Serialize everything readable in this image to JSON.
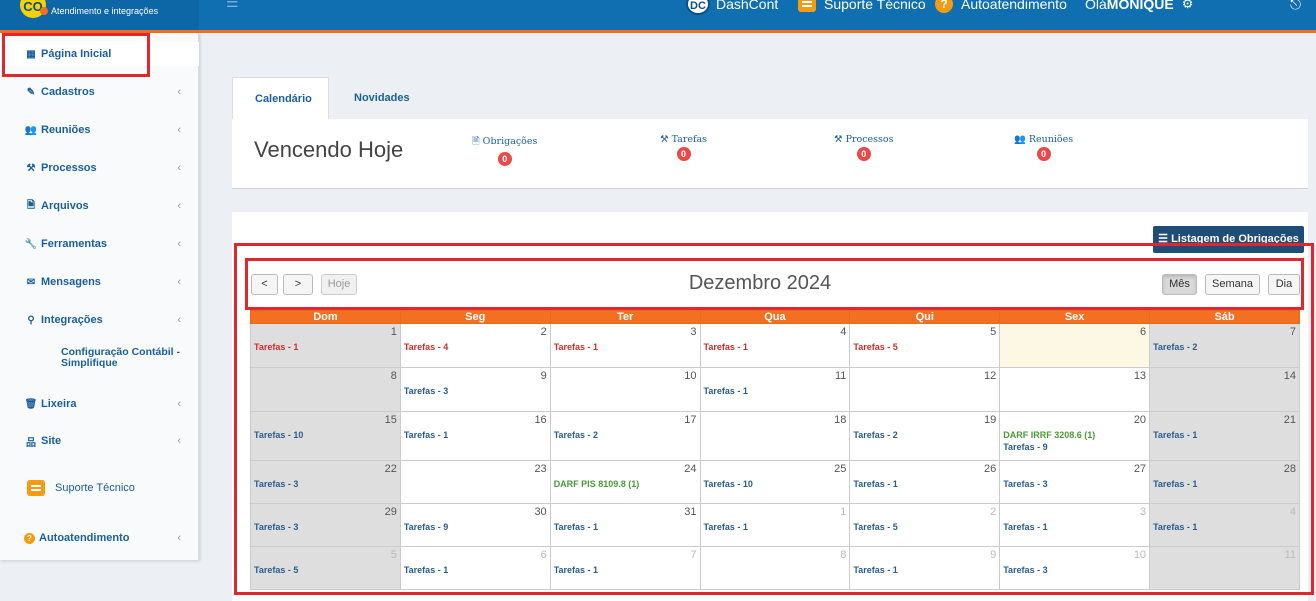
{
  "brand": {
    "logo_text": "CO",
    "subtitle": "Atendimento e integrações"
  },
  "topnav": {
    "dashcont": "DashCont",
    "dashcont_logo": "DC",
    "suporte": "Suporte Técnico",
    "autoatendimento": "Autoatendimento",
    "greeting_prefix": "Olá ",
    "user": "MONIQUE"
  },
  "sidebar": {
    "items": [
      {
        "label": "Página Inicial",
        "icon": "dashboard-icon",
        "glyph": "▦"
      },
      {
        "label": "Cadastros",
        "icon": "edit-icon",
        "glyph": "✎"
      },
      {
        "label": "Reuniões",
        "icon": "users-icon",
        "glyph": "👥"
      },
      {
        "label": "Processos",
        "icon": "gavel-icon",
        "glyph": "⚒"
      },
      {
        "label": "Arquivos",
        "icon": "file-icon",
        "glyph": "🗎"
      },
      {
        "label": "Ferramentas",
        "icon": "wrench-icon",
        "glyph": "🔧"
      },
      {
        "label": "Mensagens",
        "icon": "envelope-icon",
        "glyph": "✉"
      },
      {
        "label": "Integrações",
        "icon": "plug-icon",
        "glyph": "⚲"
      },
      {
        "label": "Lixeira",
        "icon": "trash-icon",
        "glyph": "🗑"
      },
      {
        "label": "Site",
        "icon": "sitemap-icon",
        "glyph": "品"
      },
      {
        "label": "Suporte Técnico",
        "icon": "chat-icon"
      },
      {
        "label": "Autoatendimento",
        "icon": "help-icon"
      }
    ],
    "integracoes_sub": "Configuração Contábil - Simplifique"
  },
  "tabs": [
    "Calendário",
    "Novidades"
  ],
  "vencendo": {
    "title": "Vencendo Hoje",
    "stats": [
      {
        "label": "Obrigações",
        "count": "0",
        "glyph": "🗎"
      },
      {
        "label": "Tarefas",
        "count": "0",
        "glyph": "⚒"
      },
      {
        "label": "Processos",
        "count": "0",
        "glyph": "⚒"
      },
      {
        "label": "Reuniões",
        "count": "0",
        "glyph": "👥"
      }
    ]
  },
  "calendar": {
    "listagem_button": "Listagem de Obrigações",
    "prev": "<",
    "next": ">",
    "today_button": "Hoje",
    "title": "Dezembro 2024",
    "views": [
      "Mês",
      "Semana",
      "Dia"
    ],
    "weekdays": [
      "Dom",
      "Seg",
      "Ter",
      "Qua",
      "Qui",
      "Sex",
      "Sáb"
    ],
    "weeks": [
      [
        {
          "d": "1",
          "ev": [
            [
              "Tarefas - 1",
              "red"
            ]
          ]
        },
        {
          "d": "2",
          "ev": [
            [
              "Tarefas - 4",
              "red"
            ]
          ]
        },
        {
          "d": "3",
          "ev": [
            [
              "Tarefas - 1",
              "red"
            ]
          ]
        },
        {
          "d": "4",
          "ev": [
            [
              "Tarefas - 1",
              "red"
            ]
          ]
        },
        {
          "d": "5",
          "ev": [
            [
              "Tarefas - 5",
              "red"
            ]
          ]
        },
        {
          "d": "6",
          "ev": [],
          "today": true
        },
        {
          "d": "7",
          "ev": [
            [
              "Tarefas - 2",
              "blue"
            ]
          ]
        }
      ],
      [
        {
          "d": "8",
          "ev": []
        },
        {
          "d": "9",
          "ev": [
            [
              "Tarefas - 3",
              "blue"
            ]
          ]
        },
        {
          "d": "10",
          "ev": []
        },
        {
          "d": "11",
          "ev": [
            [
              "Tarefas - 1",
              "blue"
            ]
          ]
        },
        {
          "d": "12",
          "ev": []
        },
        {
          "d": "13",
          "ev": []
        },
        {
          "d": "14",
          "ev": []
        }
      ],
      [
        {
          "d": "15",
          "ev": [
            [
              "Tarefas - 10",
              "blue"
            ]
          ]
        },
        {
          "d": "16",
          "ev": [
            [
              "Tarefas - 1",
              "blue"
            ]
          ]
        },
        {
          "d": "17",
          "ev": [
            [
              "Tarefas - 2",
              "blue"
            ]
          ]
        },
        {
          "d": "18",
          "ev": []
        },
        {
          "d": "19",
          "ev": [
            [
              "Tarefas - 2",
              "blue"
            ]
          ]
        },
        {
          "d": "20",
          "ev": [
            [
              "DARF IRRF 3208.6 (1)",
              "green"
            ],
            [
              "Tarefas - 9",
              "blue"
            ]
          ]
        },
        {
          "d": "21",
          "ev": [
            [
              "Tarefas - 1",
              "blue"
            ]
          ]
        }
      ],
      [
        {
          "d": "22",
          "ev": [
            [
              "Tarefas - 3",
              "blue"
            ]
          ]
        },
        {
          "d": "23",
          "ev": []
        },
        {
          "d": "24",
          "ev": [
            [
              "DARF PIS 8109.8 (1)",
              "green"
            ]
          ]
        },
        {
          "d": "25",
          "ev": [
            [
              "Tarefas - 10",
              "blue"
            ]
          ]
        },
        {
          "d": "26",
          "ev": [
            [
              "Tarefas - 1",
              "blue"
            ]
          ]
        },
        {
          "d": "27",
          "ev": [
            [
              "Tarefas - 3",
              "blue"
            ]
          ]
        },
        {
          "d": "28",
          "ev": [
            [
              "Tarefas - 1",
              "blue"
            ]
          ]
        }
      ],
      [
        {
          "d": "29",
          "ev": [
            [
              "Tarefas - 3",
              "blue"
            ]
          ]
        },
        {
          "d": "30",
          "ev": [
            [
              "Tarefas - 9",
              "blue"
            ]
          ]
        },
        {
          "d": "31",
          "ev": [
            [
              "Tarefas - 1",
              "blue"
            ]
          ]
        },
        {
          "d": "1",
          "other": true,
          "ev": [
            [
              "Tarefas - 1",
              "blue"
            ]
          ]
        },
        {
          "d": "2",
          "other": true,
          "ev": [
            [
              "Tarefas - 5",
              "blue"
            ]
          ]
        },
        {
          "d": "3",
          "other": true,
          "ev": [
            [
              "Tarefas - 1",
              "blue"
            ]
          ]
        },
        {
          "d": "4",
          "other": true,
          "ev": [
            [
              "Tarefas - 1",
              "blue"
            ]
          ]
        }
      ],
      [
        {
          "d": "5",
          "other": true,
          "ev": [
            [
              "Tarefas - 5",
              "blue"
            ]
          ]
        },
        {
          "d": "6",
          "other": true,
          "ev": [
            [
              "Tarefas - 1",
              "blue"
            ]
          ]
        },
        {
          "d": "7",
          "other": true,
          "ev": [
            [
              "Tarefas - 1",
              "blue"
            ]
          ]
        },
        {
          "d": "8",
          "other": true,
          "ev": []
        },
        {
          "d": "9",
          "other": true,
          "ev": [
            [
              "Tarefas - 1",
              "blue"
            ]
          ]
        },
        {
          "d": "10",
          "other": true,
          "ev": [
            [
              "Tarefas - 3",
              "blue"
            ]
          ]
        },
        {
          "d": "11",
          "other": true,
          "ev": []
        }
      ]
    ]
  },
  "colors": {
    "topbar": "#0f6fb0",
    "accent": "#f36f21",
    "highlight": "#e0262e",
    "badge": "#e84a4a"
  }
}
